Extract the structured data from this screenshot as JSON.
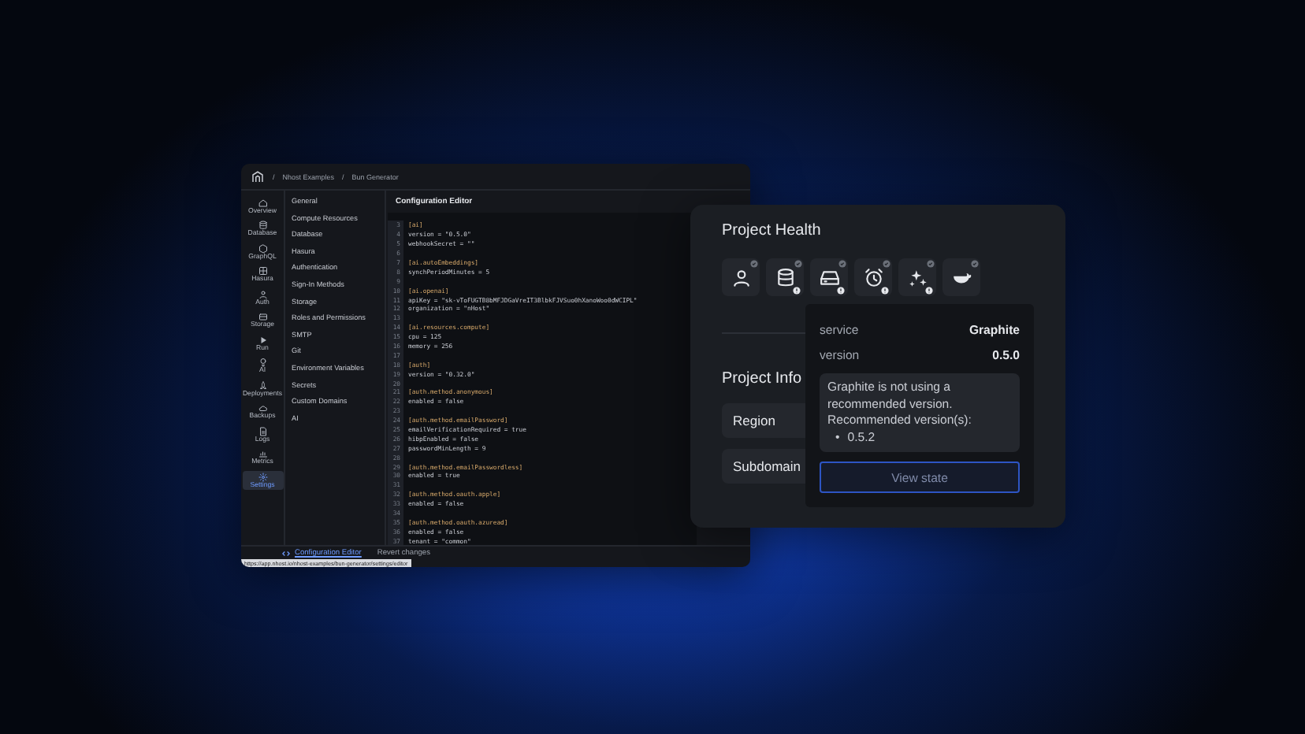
{
  "app": {
    "breadcrumb_separator": "/",
    "breadcrumb": [
      "Nhost Examples",
      "Bun Generator"
    ],
    "rail": [
      {
        "label": "Overview",
        "kind": "home",
        "selected": false
      },
      {
        "label": "Database",
        "kind": "database",
        "selected": false
      },
      {
        "label": "GraphQL",
        "kind": "graph",
        "selected": false
      },
      {
        "label": "Hasura",
        "kind": "grid",
        "selected": false
      },
      {
        "label": "Auth",
        "kind": "user",
        "selected": false
      },
      {
        "label": "Storage",
        "kind": "box",
        "selected": false
      },
      {
        "label": "Run",
        "kind": "play",
        "selected": false
      },
      {
        "label": "AI",
        "kind": "bulb",
        "selected": false
      },
      {
        "label": "Deployments",
        "kind": "rocket",
        "selected": false
      },
      {
        "label": "Backups",
        "kind": "cloud",
        "selected": false
      },
      {
        "label": "Logs",
        "kind": "doc",
        "selected": false
      },
      {
        "label": "Metrics",
        "kind": "chart",
        "selected": false
      },
      {
        "label": "Settings",
        "kind": "gear",
        "selected": true
      }
    ],
    "settings_menu": [
      "General",
      "Compute Resources",
      "Database",
      "Hasura",
      "Authentication",
      "Sign-In Methods",
      "Storage",
      "Roles and Permissions",
      "SMTP",
      "Git",
      "Environment Variables",
      "Secrets",
      "Custom Domains",
      "AI"
    ],
    "editor": {
      "title": "Configuration Editor",
      "lines": [
        {
          "number": "3",
          "kind": "section",
          "text": "[ai]"
        },
        {
          "number": "4",
          "kind": "setting",
          "text": "version = \"0.5.0\""
        },
        {
          "number": "5",
          "kind": "setting",
          "text": "webhookSecret = \"\""
        },
        {
          "number": "6",
          "kind": "blank"
        },
        {
          "number": "7",
          "kind": "section",
          "text": "[ai.autoEmbeddings]"
        },
        {
          "number": "8",
          "kind": "setting",
          "text": "synchPeriodMinutes = 5"
        },
        {
          "number": "9",
          "kind": "blank"
        },
        {
          "number": "10",
          "kind": "section",
          "text": "[ai.openai]"
        },
        {
          "number": "11",
          "kind": "setting",
          "text": "apiKey = \"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\""
        },
        {
          "number": "12",
          "kind": "setting",
          "text": "organization = \"nHost\""
        },
        {
          "number": "13",
          "kind": "blank"
        },
        {
          "number": "14",
          "kind": "section",
          "text": "[ai.resources.compute]"
        },
        {
          "number": "15",
          "kind": "setting",
          "text": "cpu = 125"
        },
        {
          "number": "16",
          "kind": "setting",
          "text": "memory = 256"
        },
        {
          "number": "17",
          "kind": "blank"
        },
        {
          "number": "18",
          "kind": "section",
          "text": "[auth]"
        },
        {
          "number": "19",
          "kind": "setting",
          "text": "version = \"0.32.0\""
        },
        {
          "number": "20",
          "kind": "blank"
        },
        {
          "number": "21",
          "kind": "section",
          "text": "[auth.method.anonymous]"
        },
        {
          "number": "22",
          "kind": "setting",
          "text": "enabled = false"
        },
        {
          "number": "23",
          "kind": "blank"
        },
        {
          "number": "24",
          "kind": "section",
          "text": "[auth.method.emailPassword]"
        },
        {
          "number": "25",
          "kind": "setting",
          "text": "emailVerificationRequired = true"
        },
        {
          "number": "26",
          "kind": "setting",
          "text": "hibpEnabled = false"
        },
        {
          "number": "27",
          "kind": "setting",
          "text": "passwordMinLength = 9"
        },
        {
          "number": "28",
          "kind": "blank"
        },
        {
          "number": "29",
          "kind": "section",
          "text": "[auth.method.emailPasswordless]"
        },
        {
          "number": "30",
          "kind": "setting",
          "text": "enabled = true"
        },
        {
          "number": "31",
          "kind": "blank"
        },
        {
          "number": "32",
          "kind": "section",
          "text": "[auth.method.oauth.apple]"
        },
        {
          "number": "33",
          "kind": "setting",
          "text": "enabled = false"
        },
        {
          "number": "34",
          "kind": "blank"
        },
        {
          "number": "35",
          "kind": "section",
          "text": "[auth.method.oauth.azuread]"
        },
        {
          "number": "36",
          "kind": "setting",
          "text": "enabled = false"
        },
        {
          "number": "37",
          "kind": "setting",
          "text": "tenant = \"common\""
        }
      ]
    },
    "footer": {
      "editor_tab": "Configuration Editor",
      "revert": "Revert changes"
    },
    "status_url": "https://app.nhost.io/nhost-examples/bun-generator/settings/editor"
  },
  "health": {
    "title": "Project Health",
    "services": [
      {
        "kind": "user",
        "warning": false
      },
      {
        "kind": "database",
        "warning": true
      },
      {
        "kind": "drive",
        "warning": true
      },
      {
        "kind": "alarm",
        "warning": true
      },
      {
        "kind": "sparkles",
        "warning": true
      },
      {
        "kind": "whale",
        "warning": false
      }
    ],
    "info_title": "Project Info",
    "info_rows": [
      "Region",
      "Subdomain"
    ]
  },
  "tooltip": {
    "service_label": "service",
    "service_value": "Graphite",
    "version_label": "version",
    "version_value": "0.5.0",
    "message": "Graphite is not using a recommended version. Recommended version(s):",
    "bullet": "•",
    "recommended": [
      "0.5.2"
    ],
    "button": "View state"
  }
}
